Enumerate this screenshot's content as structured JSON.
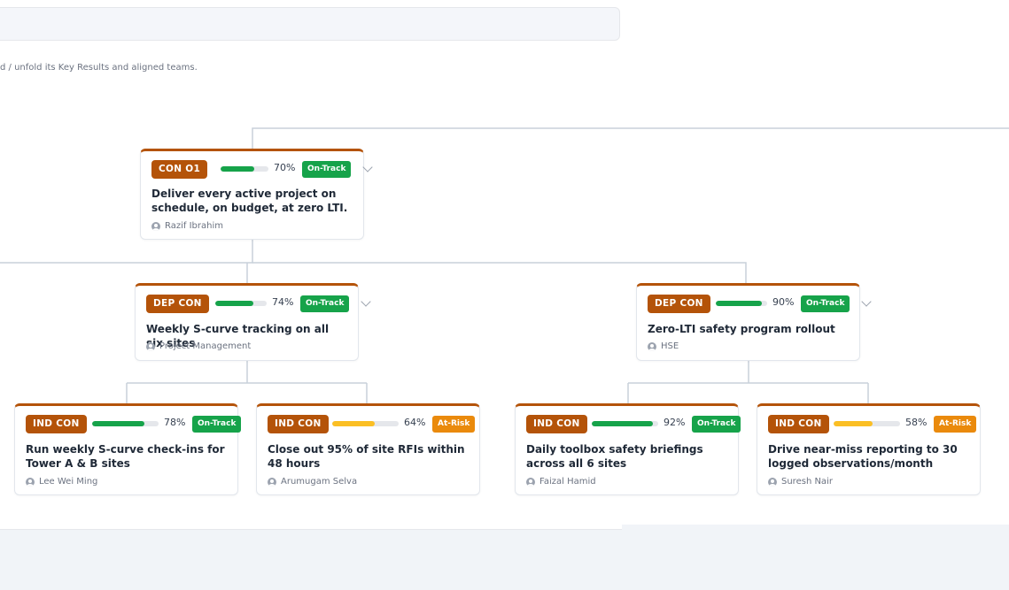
{
  "hint": "d / unfold its Key Results and aligned teams.",
  "colors": {
    "level": "#b45309",
    "on_track": "#16a34a",
    "at_risk": "#ea8a0c",
    "bar_green": "#16a34a",
    "bar_yellow": "#fbbf24",
    "connector": "#c8d0da"
  },
  "nodes": [
    {
      "level": "CON O1",
      "progress": 70,
      "progress_label": "70%",
      "status": "On-Track",
      "title": "Deliver every active project on schedule, on budget, at zero LTI.",
      "owner": "Razif Ibrahim",
      "expandable": true
    },
    {
      "level": "DEP CON",
      "progress": 74,
      "progress_label": "74%",
      "status": "On-Track",
      "title": "Weekly S-curve tracking on all six sites",
      "owner": "Project Management",
      "expandable": true
    },
    {
      "level": "DEP CON",
      "progress": 90,
      "progress_label": "90%",
      "status": "On-Track",
      "title": "Zero-LTI safety program rollout",
      "owner": "HSE",
      "expandable": true
    },
    {
      "level": "IND CON",
      "progress": 78,
      "progress_label": "78%",
      "status": "On-Track",
      "title": "Run weekly S-curve check-ins for Tower A & B sites",
      "owner": "Lee Wei Ming",
      "expandable": false
    },
    {
      "level": "IND CON",
      "progress": 64,
      "progress_label": "64%",
      "status": "At-Risk",
      "title": "Close out 95% of site RFIs within 48 hours",
      "owner": "Arumugam Selva",
      "expandable": false
    },
    {
      "level": "IND CON",
      "progress": 92,
      "progress_label": "92%",
      "status": "On-Track",
      "title": "Daily toolbox safety briefings across all 6 sites",
      "owner": "Faizal Hamid",
      "expandable": false
    },
    {
      "level": "IND CON",
      "progress": 58,
      "progress_label": "58%",
      "status": "At-Risk",
      "title": "Drive near-miss reporting to 30 logged observations/month",
      "owner": "Suresh Nair",
      "expandable": false
    }
  ]
}
